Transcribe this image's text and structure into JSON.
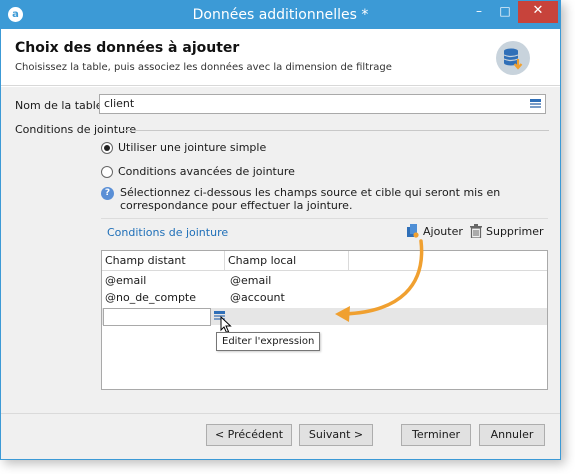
{
  "window": {
    "title": "Données additionnelles *",
    "app_icon": "adobe-campaign-icon",
    "controls": {
      "minimize": "–",
      "maximize": "□",
      "close": "✕"
    }
  },
  "header": {
    "title": "Choix des données à ajouter",
    "subtitle": "Choisissez la table, puis associez les données avec la dimension de filtrage",
    "icon": "database-download-icon"
  },
  "table_name": {
    "label": "Nom de la table :",
    "value": "client"
  },
  "conditions": {
    "group_label": "Conditions de jointure",
    "options": [
      {
        "label": "Utiliser une jointure simple",
        "checked": true
      },
      {
        "label": "Conditions avancées de jointure",
        "checked": false
      }
    ],
    "help_text": "Sélectionnez ci-dessous les champs source et cible qui seront mis en correspondance pour effectuer la jointure.",
    "toolbar": {
      "title": "Conditions de jointure",
      "add_label": "Ajouter",
      "delete_label": "Supprimer"
    },
    "grid": {
      "columns": [
        "Champ distant",
        "Champ local"
      ],
      "rows": [
        {
          "remote": "@email",
          "local": "@email"
        },
        {
          "remote": "@no_de_compte",
          "local": "@account"
        },
        {
          "remote": "",
          "local": ""
        }
      ]
    },
    "tooltip": "Editer l'expression"
  },
  "colors": {
    "titlebar": "#3c9ad6",
    "close_button": "#c7433b",
    "link": "#1f6fb8",
    "arrow": "#f0a030"
  },
  "buttons": {
    "previous": "< Précédent",
    "next": "Suivant >",
    "finish": "Terminer",
    "cancel": "Annuler"
  }
}
